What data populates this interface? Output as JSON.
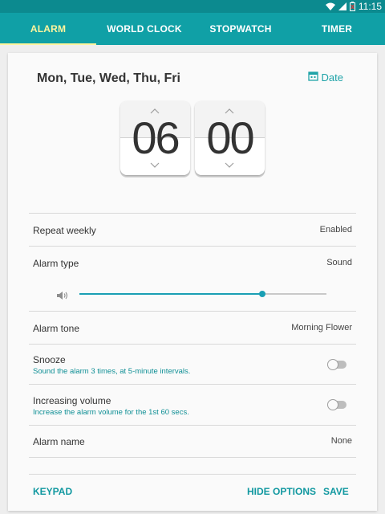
{
  "status_bar": {
    "time": "11:15",
    "icons": [
      "wifi-icon",
      "signal-icon",
      "battery-icon"
    ],
    "color": "#0c8a8f"
  },
  "tabs": [
    {
      "label": "ALARM",
      "active": true
    },
    {
      "label": "WORLD CLOCK",
      "active": false
    },
    {
      "label": "STOPWATCH",
      "active": false
    },
    {
      "label": "TIMER",
      "active": false
    }
  ],
  "colors": {
    "accent": "#10a0a6",
    "active_tab": "#fff59d",
    "slider": "#1a9fb4"
  },
  "alarm": {
    "days": "Mon, Tue, Wed, Thu, Fri",
    "date_label": "Date",
    "hours": "06",
    "minutes": "00"
  },
  "settings": {
    "repeat": {
      "label": "Repeat weekly",
      "value": "Enabled"
    },
    "type": {
      "label": "Alarm type",
      "value": "Sound"
    },
    "volume_level": 0.74,
    "tone": {
      "label": "Alarm tone",
      "value": "Morning Flower"
    },
    "snooze": {
      "label": "Snooze",
      "description": "Sound the alarm 3 times, at 5-minute intervals.",
      "enabled": false
    },
    "increasing": {
      "label": "Increasing volume",
      "description": "Increase the alarm volume for the 1st 60 secs.",
      "enabled": false
    },
    "name": {
      "label": "Alarm name",
      "value": "None"
    }
  },
  "footer": {
    "keypad": "KEYPAD",
    "hide_options": "HIDE OPTIONS",
    "save": "SAVE"
  }
}
